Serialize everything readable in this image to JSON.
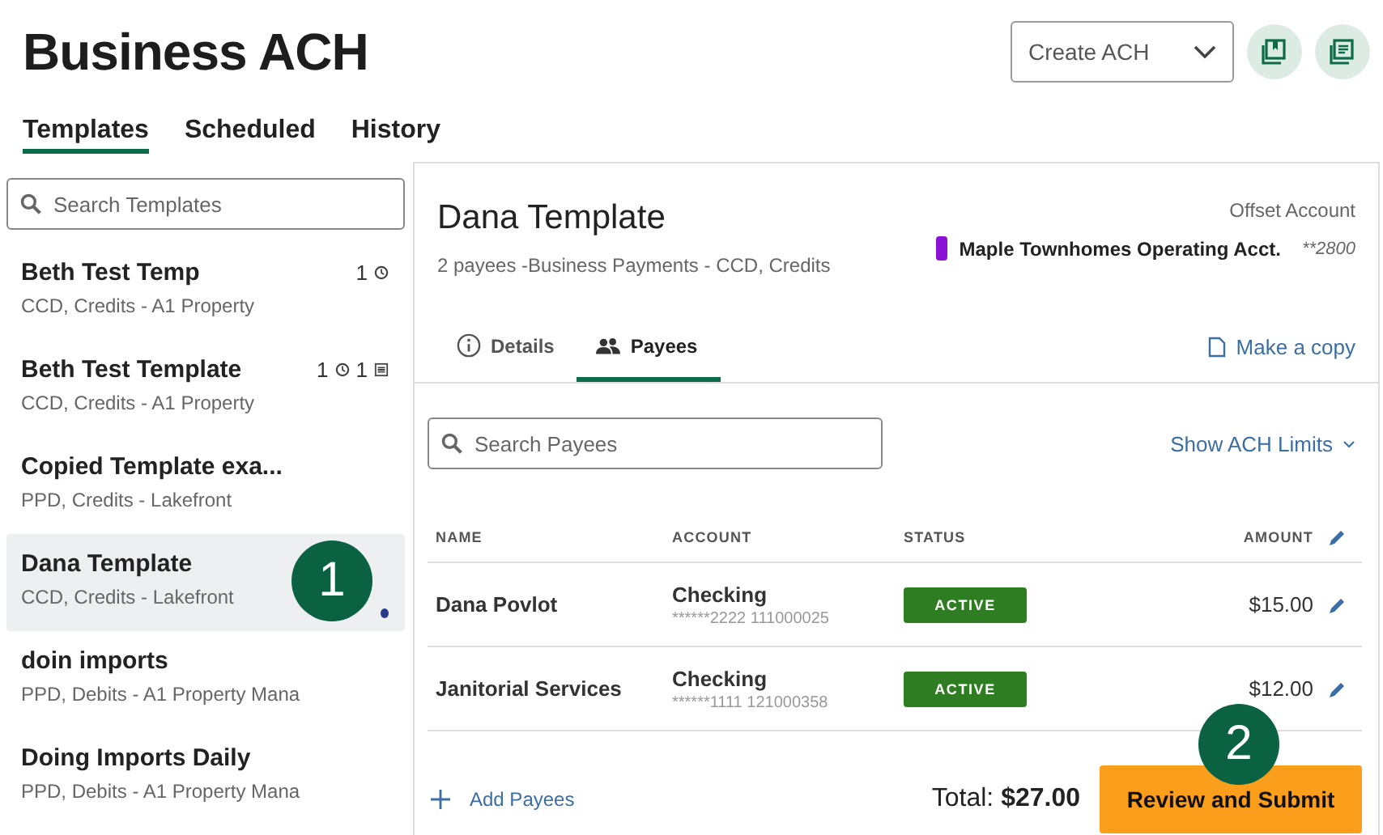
{
  "title": "Business ACH",
  "create_select": {
    "value": "Create ACH"
  },
  "nav_tabs": [
    {
      "label": "Templates",
      "selected": true
    },
    {
      "label": "Scheduled",
      "selected": false
    },
    {
      "label": "History",
      "selected": false
    }
  ],
  "template_search": {
    "placeholder": "Search Templates"
  },
  "templates": [
    {
      "name": "Beth Test Temp",
      "sub": "CCD, Credits - A1 Property",
      "selected": false,
      "badges": [
        {
          "count": "1",
          "kind": "clock"
        }
      ]
    },
    {
      "name": "Beth Test Template",
      "sub": "CCD, Credits - A1 Property",
      "selected": false,
      "badges": [
        {
          "count": "1",
          "kind": "clock"
        },
        {
          "count": "1",
          "kind": "list"
        }
      ]
    },
    {
      "name": "Copied Template exa...",
      "sub": "PPD, Credits - Lakefront",
      "selected": false
    },
    {
      "name": "Dana Template",
      "sub": "CCD, Credits - Lakefront",
      "selected": true
    },
    {
      "name": "doin imports",
      "sub": "PPD, Debits - A1 Property Mana",
      "selected": false
    },
    {
      "name": "Doing Imports Daily",
      "sub": "PPD, Debits - A1 Property Mana",
      "selected": false
    }
  ],
  "detail": {
    "title": "Dana Template",
    "subtitle": "2 payees -Business Payments - CCD, Credits",
    "offset_label": "Offset Account",
    "offset_account": {
      "name": "Maple Townhomes Operating Acct.",
      "number": "**2800",
      "color": "#8a12d6"
    },
    "tabs": [
      {
        "label": "Details",
        "kind": "info",
        "selected": false
      },
      {
        "label": "Payees",
        "kind": "people",
        "selected": true
      }
    ],
    "copy_link": "Make a copy",
    "payee_search": {
      "placeholder": "Search Payees"
    },
    "limits_link": "Show ACH Limits",
    "columns": [
      "NAME",
      "ACCOUNT",
      "STATUS",
      "AMOUNT"
    ],
    "payees": [
      {
        "name": "Dana Povlot",
        "account_type": "Checking",
        "account_number": "******2222 111000025",
        "status": "ACTIVE",
        "amount": "$15.00"
      },
      {
        "name": "Janitorial Services",
        "account_type": "Checking",
        "account_number": "******1111 121000358",
        "status": "ACTIVE",
        "amount": "$12.00"
      }
    ],
    "add_link": "Add Payees",
    "total": "Total: **$27.00**",
    "submit_button": "Review and Submit"
  },
  "callouts": [
    {
      "label": "1"
    },
    {
      "label": "2"
    }
  ]
}
